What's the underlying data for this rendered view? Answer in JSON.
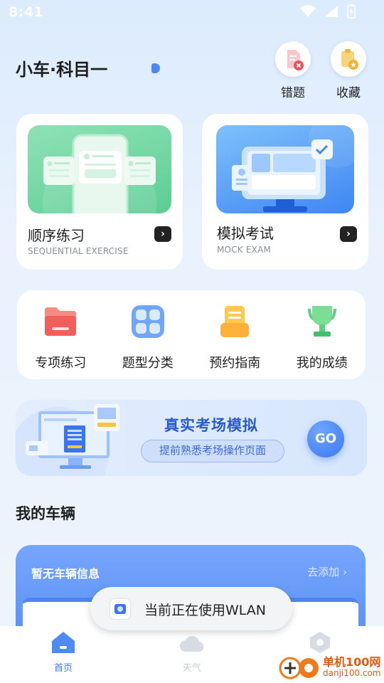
{
  "status_bar": {
    "time": "8:41"
  },
  "header": {
    "title": "小车·科目一",
    "wrong_questions_label": "错题",
    "favorites_label": "收藏"
  },
  "cards": [
    {
      "title": "顺序练习",
      "subtitle": "SEQUENTIAL EXERCISE"
    },
    {
      "title": "模拟考试",
      "subtitle": "MOCK EXAM"
    }
  ],
  "quick_menu": [
    {
      "label": "专项练习",
      "icon": "folder-icon"
    },
    {
      "label": "题型分类",
      "icon": "grid-icon"
    },
    {
      "label": "预约指南",
      "icon": "clipboard-icon"
    },
    {
      "label": "我的成绩",
      "icon": "trophy-icon"
    }
  ],
  "exam_banner": {
    "title": "真实考场模拟",
    "subtitle": "提前熟悉考场操作页面",
    "go_label": "GO"
  },
  "vehicle_section": {
    "title": "我的车辆",
    "empty_text": "暂无车辆信息",
    "add_label": "去添加 ›"
  },
  "toast": {
    "text": "当前正在使用WLAN"
  },
  "bottom_nav": [
    {
      "label": "首页",
      "active": true
    },
    {
      "label": "天气",
      "active": false
    },
    {
      "label": "",
      "active": false
    }
  ],
  "watermark": {
    "brand": "单机100网",
    "url": "danji100.com"
  },
  "colors": {
    "accent": "#4e86f5",
    "title_blue": "#2a5cc8",
    "nav_active": "#3f7cf0"
  }
}
